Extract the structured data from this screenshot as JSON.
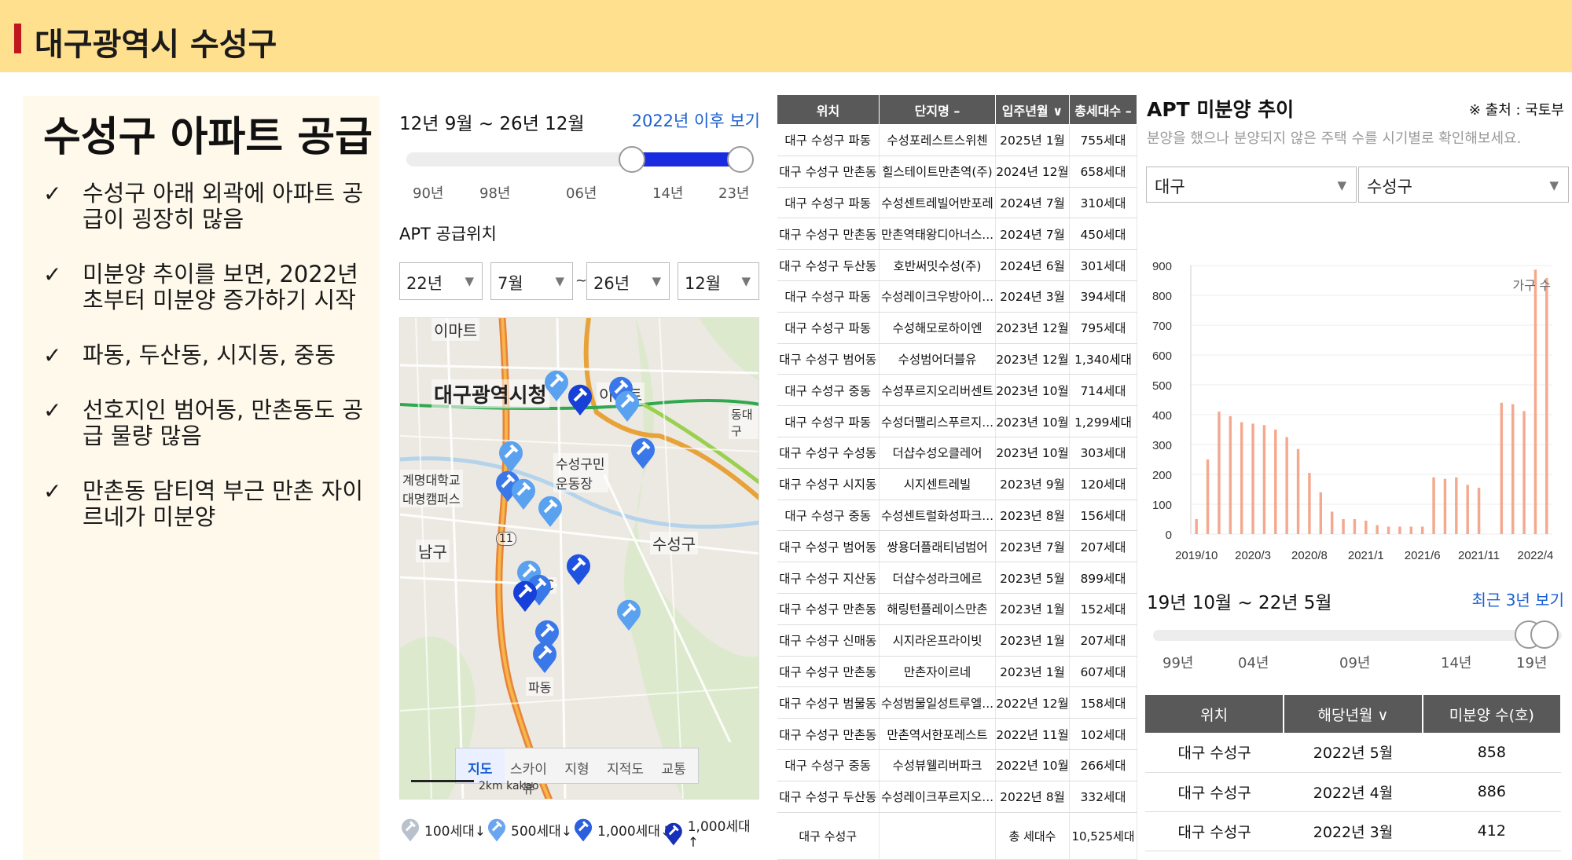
{
  "header": {
    "title": "대구광역시 수성구"
  },
  "left": {
    "title": "수성구 아파트 공급",
    "bullets": [
      "수성구 아래 외곽에 아파트 공급이 굉장히 많음",
      "미분양 추이를 보면, 2022년 초부터 미분양 증가하기 시작",
      "파동, 두산동, 시지동, 중동",
      "선호지인 범어동, 만촌동도 공급 물량 많음",
      "만촌동 담티역 부근 만촌 자이르네가 미분양"
    ]
  },
  "map_section": {
    "range_label": "12년 9월 ~ 26년 12월",
    "after_2022_link": "2022년 이후 보기",
    "slider_ticks": [
      "90년",
      "98년",
      "06년",
      "14년",
      "23년"
    ],
    "supply_location_label": "APT 공급위치",
    "selects": {
      "start_year": "22년",
      "start_month": "7월",
      "tilde": "~",
      "end_year": "26년",
      "end_month": "12월"
    },
    "map_labels": {
      "emart1": "이마트",
      "city_hall": "대구광역시청",
      "emart2": "이마트",
      "dongdaegu": "동대구",
      "keimyung": "계명대학교\n대명캠퍼스",
      "stadium": "수성구민\n운동장",
      "namgu": "남구",
      "suseonggu": "수성구",
      "padong": "파동",
      "route": "11",
      "ic": "IC",
      "scale": "2km kakao"
    },
    "map_tabs": [
      "지도",
      "스카이뷰",
      "지형",
      "지적도",
      "교통"
    ],
    "legend": [
      "100세대↓",
      "500세대↓",
      "1,000세대↓",
      "1,000세대↑"
    ]
  },
  "supply_table": {
    "headers": [
      "위치",
      "단지명 –",
      "입주년월 ∨",
      "총세대수 –"
    ],
    "rows": [
      [
        "대구 수성구 파동",
        "수성포레스트스위첸",
        "2025년 1월",
        "755세대"
      ],
      [
        "대구 수성구 만촌동",
        "힐스테이트만촌역(주)",
        "2024년 12월",
        "658세대"
      ],
      [
        "대구 수성구 파동",
        "수성센트레빌어반포레",
        "2024년 7월",
        "310세대"
      ],
      [
        "대구 수성구 만촌동",
        "만촌역태왕디아너스...",
        "2024년 7월",
        "450세대"
      ],
      [
        "대구 수성구 두산동",
        "호반써밋수성(주)",
        "2024년 6월",
        "301세대"
      ],
      [
        "대구 수성구 파동",
        "수성레이크우방아이...",
        "2024년 3월",
        "394세대"
      ],
      [
        "대구 수성구 파동",
        "수성해모로하이엔",
        "2023년 12월",
        "795세대"
      ],
      [
        "대구 수성구 범어동",
        "수성범어더블유",
        "2023년 12월",
        "1,340세대"
      ],
      [
        "대구 수성구 중동",
        "수성푸르지오리버센트",
        "2023년 10월",
        "714세대"
      ],
      [
        "대구 수성구 파동",
        "수성더팰리스푸르지...",
        "2023년 10월",
        "1,299세대"
      ],
      [
        "대구 수성구 수성동",
        "더샵수성오클레어",
        "2023년 10월",
        "303세대"
      ],
      [
        "대구 수성구 시지동",
        "시지센트레빌",
        "2023년 9월",
        "120세대"
      ],
      [
        "대구 수성구 중동",
        "수성센트럴화성파크...",
        "2023년 8월",
        "156세대"
      ],
      [
        "대구 수성구 범어동",
        "쌍용더플래티넘범어",
        "2023년 7월",
        "207세대"
      ],
      [
        "대구 수성구 지산동",
        "더샵수성라크에르",
        "2023년 5월",
        "899세대"
      ],
      [
        "대구 수성구 만촌동",
        "해링턴플레이스만촌",
        "2023년 1월",
        "152세대"
      ],
      [
        "대구 수성구 신매동",
        "시지라온프라이빗",
        "2023년 1월",
        "207세대"
      ],
      [
        "대구 수성구 만촌동",
        "만촌자이르네",
        "2023년 1월",
        "607세대"
      ],
      [
        "대구 수성구 범물동",
        "수성범물일성트루엘...",
        "2022년 12월",
        "158세대"
      ],
      [
        "대구 수성구 만촌동",
        "만촌역서한포레스트",
        "2022년 11월",
        "102세대"
      ],
      [
        "대구 수성구 중동",
        "수성뷰웰리버파크",
        "2022년 10월",
        "266세대"
      ],
      [
        "대구 수성구 두산동",
        "수성레이크푸르지오...",
        "2022년 8월",
        "332세대"
      ]
    ],
    "total": {
      "location": "대구 수성구",
      "label": "총 세대수",
      "value": "10,525세대"
    }
  },
  "right": {
    "title": "APT 미분양 추이",
    "source": "※ 출처 : 국토부",
    "description": "분양을 했으나 분양되지 않은 주택 수를 시기별로 확인해보세요.",
    "select_city": "대구",
    "select_district": "수성구",
    "range_label": "19년 10월 ~ 22년 5월",
    "recent3_link": "최근 3년 보기",
    "slider_ticks": [
      "99년",
      "04년",
      "09년",
      "14년",
      "19년"
    ],
    "unsold_table": {
      "headers": [
        "위치",
        "해당년월 ∨",
        "미분양 수(호)"
      ],
      "rows": [
        [
          "대구 수성구",
          "2022년 5월",
          "858"
        ],
        [
          "대구 수성구",
          "2022년 4월",
          "886"
        ],
        [
          "대구 수성구",
          "2022년 3월",
          "412"
        ]
      ]
    }
  },
  "chart_data": {
    "type": "bar",
    "legend": "가구 수",
    "bar_color": "#f4a98f",
    "ylim": [
      0,
      900
    ],
    "yticks": [
      0,
      100,
      200,
      300,
      400,
      500,
      600,
      700,
      800,
      900
    ],
    "xtick_labels": [
      "2019/10",
      "2020/3",
      "2020/8",
      "2021/1",
      "2021/6",
      "2021/11",
      "2022/4"
    ],
    "categories": [
      "2019/10",
      "2019/11",
      "2019/12",
      "2020/1",
      "2020/2",
      "2020/3",
      "2020/4",
      "2020/5",
      "2020/6",
      "2020/7",
      "2020/8",
      "2020/9",
      "2020/10",
      "2020/11",
      "2020/12",
      "2021/1",
      "2021/2",
      "2021/3",
      "2021/4",
      "2021/5",
      "2021/6",
      "2021/7",
      "2021/8",
      "2021/9",
      "2021/10",
      "2021/11",
      "2021/12",
      "2022/1",
      "2022/2",
      "2022/3",
      "2022/4",
      "2022/5"
    ],
    "values": [
      50,
      250,
      410,
      395,
      375,
      370,
      365,
      350,
      325,
      285,
      205,
      140,
      75,
      50,
      50,
      45,
      30,
      25,
      25,
      25,
      25,
      190,
      185,
      190,
      165,
      155,
      0,
      440,
      435,
      412,
      886,
      858
    ]
  }
}
